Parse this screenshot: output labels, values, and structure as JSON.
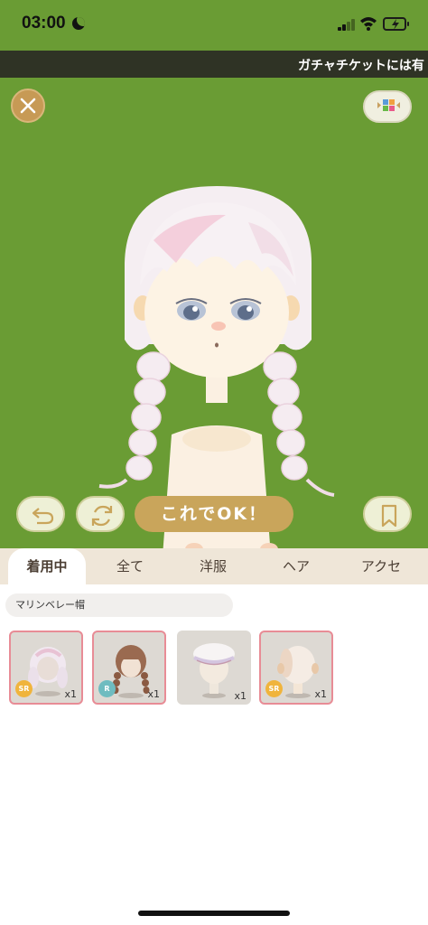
{
  "status_bar": {
    "time": "03:00"
  },
  "ticker": {
    "text": "ガチャチケットには有"
  },
  "stage": {
    "ok_label": "これでOK！"
  },
  "tabs": [
    {
      "label": "着用中",
      "active": true
    },
    {
      "label": "全て",
      "active": false
    },
    {
      "label": "洋服",
      "active": false
    },
    {
      "label": "ヘア",
      "active": false
    },
    {
      "label": "アクセ",
      "active": false
    }
  ],
  "filter": {
    "label": "マリンベレー帽"
  },
  "items": [
    {
      "name": "white-pink hair",
      "rarity": "SR",
      "rarity_color": "#f0b43c",
      "qty": "x1",
      "selected": true
    },
    {
      "name": "brown braids hair",
      "rarity": "R",
      "rarity_color": "#6fbcc0",
      "qty": "x1",
      "selected": true
    },
    {
      "name": "marine beret",
      "rarity": "",
      "qty": "x1",
      "selected": false
    },
    {
      "name": "skin",
      "rarity": "SR",
      "rarity_color": "#f0b43c",
      "qty": "x1",
      "selected": true
    }
  ],
  "colors": {
    "stage_green": "#6a9c34",
    "ok_gold": "#c9a55b",
    "tab_bar": "#efe6d8",
    "selected_border": "#e88c96"
  }
}
